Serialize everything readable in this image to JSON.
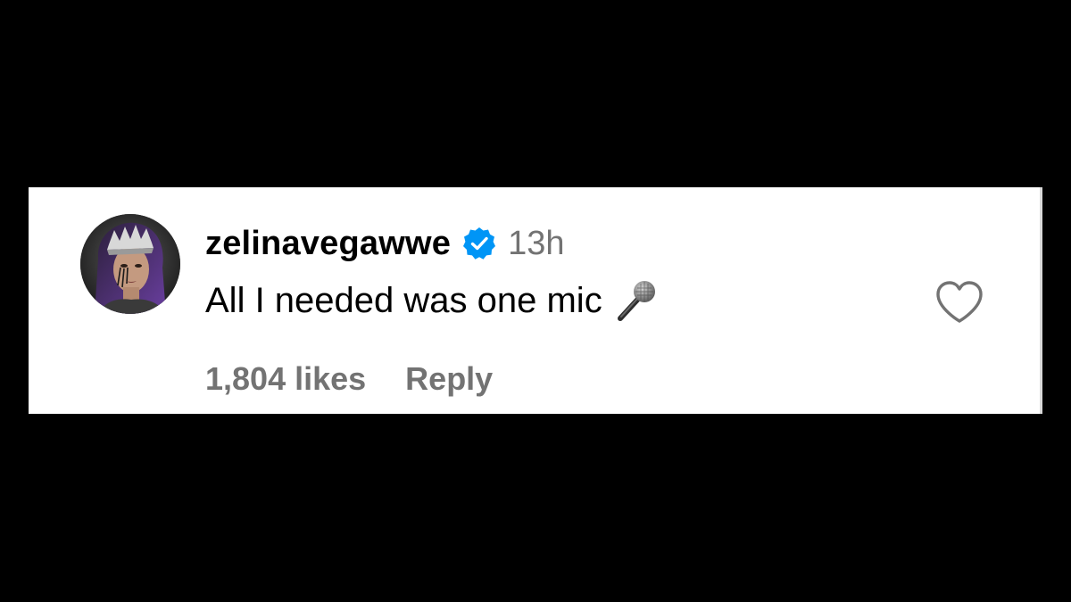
{
  "comment": {
    "username": "zelinavegawwe",
    "verified": true,
    "timestamp": "13h",
    "text": "All I needed was one mic",
    "emoji": "microphone-emoji",
    "likes": "1,804 likes",
    "reply_label": "Reply"
  },
  "colors": {
    "background": "#000000",
    "card": "#ffffff",
    "verified_badge": "#0095f6",
    "secondary_text": "#737373",
    "primary_text": "#000000"
  },
  "icons": {
    "verified": "verified-badge-icon",
    "like": "heart-outline-icon",
    "avatar": "profile-avatar"
  }
}
